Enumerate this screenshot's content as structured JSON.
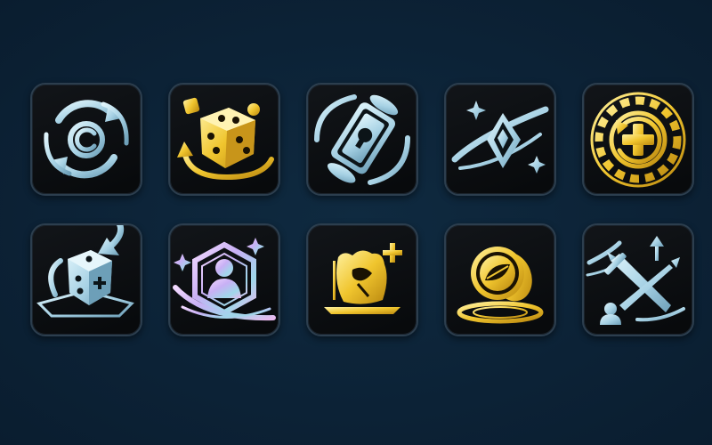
{
  "colors": {
    "background": "#0c2236",
    "tile_fill": "#0a0c0e",
    "tile_border": "#2c3e4e",
    "ice_blue": "#a9d3e6",
    "gold": "#f2cf3a",
    "iridescent": "#d6b8f2"
  },
  "icons": [
    {
      "name": "refresh-cycle-icon",
      "tint": "ice_blue"
    },
    {
      "name": "dice-roll-icon",
      "tint": "gold"
    },
    {
      "name": "card-swap-icon",
      "tint": "ice_blue"
    },
    {
      "name": "crystal-orbit-icon",
      "tint": "ice_blue"
    },
    {
      "name": "chip-heal-icon",
      "tint": "gold"
    },
    {
      "name": "dice-reroll-icon",
      "tint": "ice_blue"
    },
    {
      "name": "hero-portrait-icon",
      "tint": "iridescent"
    },
    {
      "name": "loot-bag-plus-icon",
      "tint": "gold"
    },
    {
      "name": "coin-drop-icon",
      "tint": "gold"
    },
    {
      "name": "sword-upgrade-icon",
      "tint": "ice_blue"
    }
  ]
}
